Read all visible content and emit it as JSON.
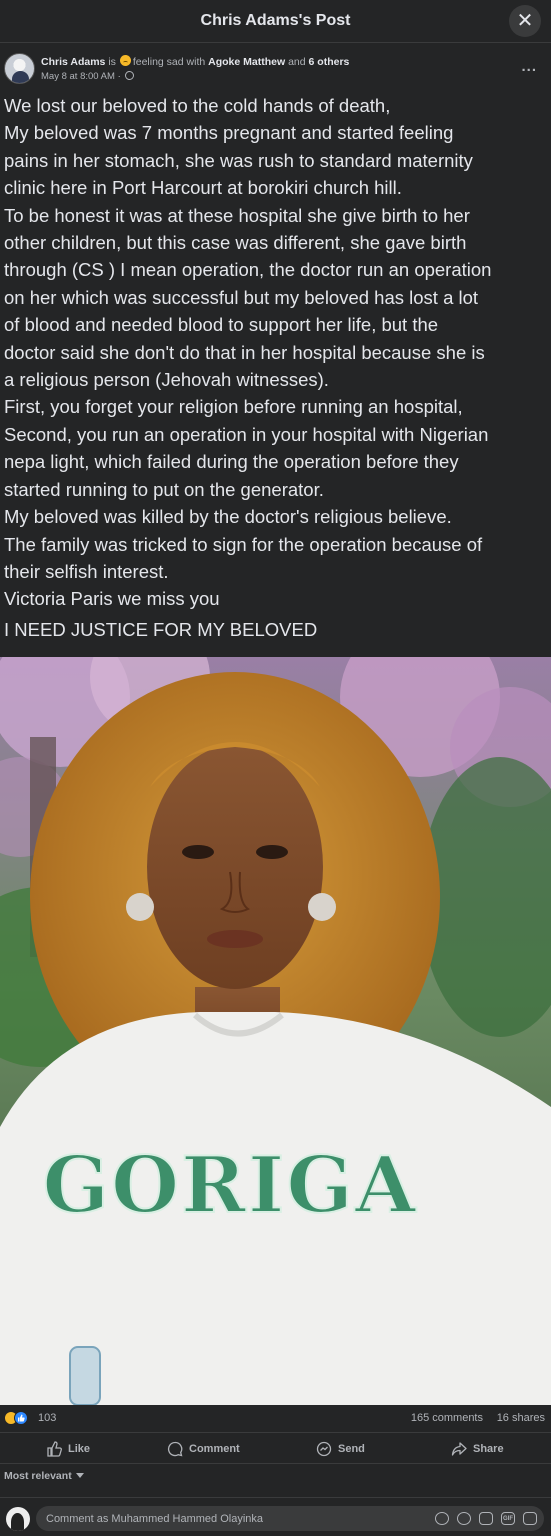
{
  "topbar": {
    "title": "Chris Adams's Post",
    "close_icon": "close-icon"
  },
  "post": {
    "author": "Chris Adams",
    "is_label": "is",
    "feeling": "feeling sad with",
    "tagged": "Agoke Matthew",
    "and_label": "and",
    "others": "6 others",
    "date": "May 8 at 8:00 AM",
    "date_sep": "·",
    "more": "...",
    "text_lines": [
      "We lost our beloved to the cold hands of death,",
      "My beloved was 7 months pregnant and started feeling",
      "pains in her stomach, she was rush to standard maternity",
      "clinic here in Port Harcourt at borokiri church hill.",
      "To be honest it was at these hospital she give birth to her",
      "other children, but this case was different, she gave birth",
      "through (CS ) I mean operation, the doctor run an operation",
      "on her which was successful but my beloved has lost a lot",
      "of blood and needed blood to support her life, but the",
      "doctor said she don't do that in her hospital because she is",
      "a religious person (Jehovah witnesses).",
      "First, you forget your religion before running an hospital,",
      "Second, you run an operation in your hospital with Nigerian",
      "nepa light, which failed during the operation before they",
      "started running to put on the generator.",
      "My beloved was killed by the doctor's religious believe.",
      "The family was tricked to sign for the operation because of",
      "their selfish interest.",
      "Victoria Paris we miss you",
      "I NEED JUSTICE FOR MY BELOVED"
    ],
    "photo_shirt_text": "GORIGA"
  },
  "stats": {
    "reactions": "103",
    "comments": "165 comments",
    "shares": "16 shares"
  },
  "actions": {
    "like": "Like",
    "comment": "Comment",
    "send": "Send",
    "share": "Share"
  },
  "sort": {
    "label": "Most relevant"
  },
  "composer": {
    "placeholder": "Comment as Muhammed Hammed Olayinka",
    "gif_label": "GIF"
  },
  "colors": {
    "background": "#242526",
    "text": "#e4e6eb",
    "muted": "#b0b3b8",
    "like_blue": "#2d88ff",
    "sad_yellow": "#f7b928"
  }
}
